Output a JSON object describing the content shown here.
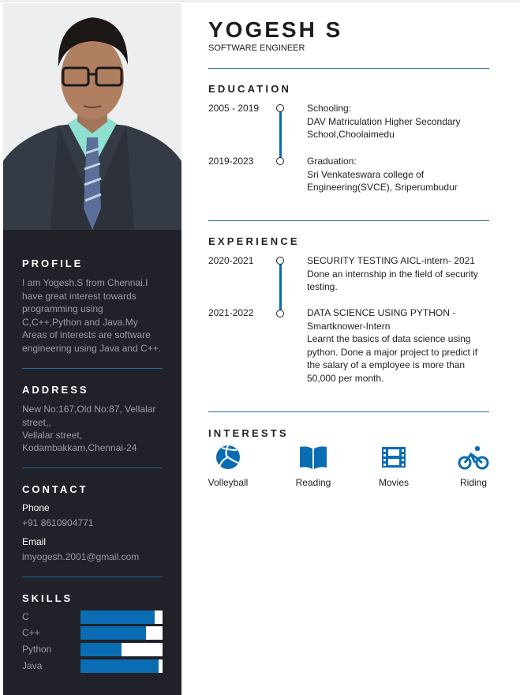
{
  "name": "YOGESH S",
  "role": "SOFTWARE ENGINEER",
  "sidebar": {
    "profile": {
      "heading": "PROFILE",
      "text": "I am Yogesh.S from Chennai.I have great interest towards programming using C,C++,Python and Java.My Areas of interests are software engineering using Java and C++."
    },
    "address": {
      "heading": "ADDRESS",
      "line1": "New No:167,Old No:87, Vellalar street,,",
      "line2": "Vellalar street,",
      "line3": "Kodambakkam,Chennai-24"
    },
    "contact": {
      "heading": "CONTACT",
      "phone_label": "Phone",
      "phone": "+91 8610904771",
      "email_label": "Email",
      "email": "imyogesh.2001@gmail.com"
    },
    "skills": {
      "heading": "SKILLS",
      "items": [
        {
          "name": "C",
          "level": 0.9
        },
        {
          "name": "C++",
          "level": 0.8
        },
        {
          "name": "Python",
          "level": 0.5
        },
        {
          "name": "Java",
          "level": 0.95
        }
      ]
    }
  },
  "education": {
    "heading": "EDUCATION",
    "items": [
      {
        "date": "2005 - 2019",
        "title": "Schooling:",
        "line1": "DAV Matriculation Higher Secondary",
        "line2": "School,Choolaimedu"
      },
      {
        "date": "2019-2023",
        "title": "Graduation:",
        "line1": "Sri Venkateswara college of",
        "line2": "Engineering(SVCE), Sriperumbudur"
      }
    ]
  },
  "experience": {
    "heading": "EXPERIENCE",
    "items": [
      {
        "date": "2020-2021",
        "title": "SECURITY TESTING AICL-intern- 2021",
        "desc": "Done an internship in the field of security testing."
      },
      {
        "date": "2021-2022",
        "title": "DATA SCIENCE USING PYTHON - Smartknower-Intern",
        "desc": "Learnt the basics of data science using python. Done a major project to predict if the salary of a employee is more than 50,000 per month."
      }
    ]
  },
  "interests": {
    "heading": "INTERESTS",
    "items": [
      {
        "label": "Volleyball",
        "icon": "volleyball-icon"
      },
      {
        "label": "Reading",
        "icon": "book-icon"
      },
      {
        "label": "Movies",
        "icon": "film-icon"
      },
      {
        "label": "Riding",
        "icon": "bicycle-icon"
      }
    ]
  },
  "colors": {
    "accent": "#0a6cb3",
    "sidebar": "#212129",
    "divider": "#1f6aa0"
  }
}
